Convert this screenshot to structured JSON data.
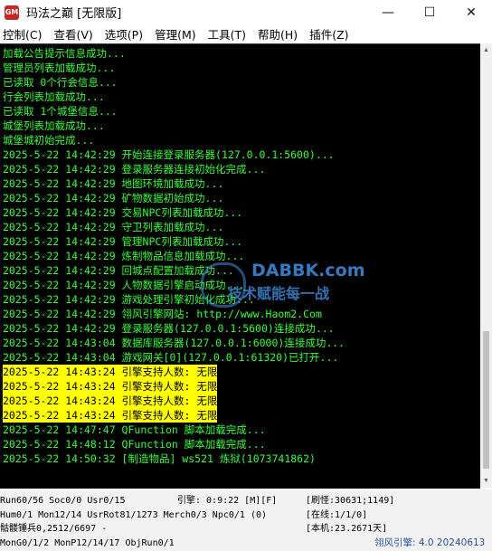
{
  "window": {
    "icon_text": "GM",
    "title": "玛法之巅 [无限版]",
    "min_glyph": "—",
    "max_glyph": "☐",
    "close_glyph": "✕"
  },
  "menu": [
    {
      "label": "控制(C)"
    },
    {
      "label": "查看(V)"
    },
    {
      "label": "选项(P)"
    },
    {
      "label": "管理(M)"
    },
    {
      "label": "工具(T)"
    },
    {
      "label": "帮助(H)"
    },
    {
      "label": "插件(Z)"
    }
  ],
  "console": {
    "text_color": "#33ff33",
    "highlight_color": "#ffff00",
    "lines": [
      {
        "text": "加载公告提示信息成功...",
        "hl": false
      },
      {
        "text": "管理员列表加载成功...",
        "hl": false
      },
      {
        "text": "已读取 0个行会信息...",
        "hl": false
      },
      {
        "text": "行会列表加载成功...",
        "hl": false
      },
      {
        "text": "已读取 1个城堡信息...",
        "hl": false
      },
      {
        "text": "城堡列表加载成功...",
        "hl": false
      },
      {
        "text": "城堡城初始完成...",
        "hl": false
      },
      {
        "text": "2025-5-22 14:42:29 开始连接登录服务器(127.0.0.1:5600)...",
        "hl": false
      },
      {
        "text": "2025-5-22 14:42:29 登录服务器连接初始化完成...",
        "hl": false
      },
      {
        "text": "2025-5-22 14:42:29 地图环境加载成功...",
        "hl": false
      },
      {
        "text": "2025-5-22 14:42:29 矿物数据初始成功...",
        "hl": false
      },
      {
        "text": "2025-5-22 14:42:29 交易NPC列表加载成功...",
        "hl": false
      },
      {
        "text": "2025-5-22 14:42:29 守卫列表加载成功...",
        "hl": false
      },
      {
        "text": "2025-5-22 14:42:29 管理NPC列表加载成功...",
        "hl": false
      },
      {
        "text": "2025-5-22 14:42:29 炼制物品信息加载成功...",
        "hl": false
      },
      {
        "text": "2025-5-22 14:42:29 回城点配置加载成功...",
        "hl": false
      },
      {
        "text": "2025-5-22 14:42:29 人物数据引擎启动成功...",
        "hl": false
      },
      {
        "text": "2025-5-22 14:42:29 游戏处理引擎初始化成功...",
        "hl": false
      },
      {
        "text": "2025-5-22 14:42:29 翎风引擎网站: http://www.Haom2.Com",
        "hl": false
      },
      {
        "text": "2025-5-22 14:42:29 登录服务器(127.0.0.1:5600)连接成功...",
        "hl": false
      },
      {
        "text": "2025-5-22 14:43:04 数据库服务器(127.0.0.1:6000)连接成功...",
        "hl": false
      },
      {
        "text": "2025-5-22 14:43:04 游戏网关[0](127.0.0.1:61320)已打开...",
        "hl": false
      },
      {
        "text": "2025-5-22 14:43:24 引擎支持人数: 无限",
        "hl": true
      },
      {
        "text": "2025-5-22 14:43:24 引擎支持人数: 无限",
        "hl": true
      },
      {
        "text": "2025-5-22 14:43:24 引擎支持人数: 无限",
        "hl": true
      },
      {
        "text": "2025-5-22 14:43:24 引擎支持人数: 无限",
        "hl": true
      },
      {
        "text": "2025-5-22 14:47:47 QFunction 脚本加载完成...",
        "hl": false
      },
      {
        "text": "2025-5-22 14:48:12 QFunction 脚本加载完成...",
        "hl": false
      },
      {
        "text": "2025-5-22 14:50:32 [制造物品] ws521 炼狱(1073741862)",
        "hl": false
      }
    ]
  },
  "scrollbar": {
    "up_glyph": "▲",
    "down_glyph": "▼"
  },
  "watermark": {
    "logo": "DABBK.com",
    "slogan": "技术赋能每一战"
  },
  "status": {
    "r1c1": "Run60/56 Soc0/0 Usr0/15",
    "r1c2": "引擎: 0:9:22 [M][F]",
    "r1c3": "[刷怪:30631;1149]",
    "r2c1": "Hum0/1 Mon12/14 UsrRot81/1273 Merch0/3 Npc0/1 (0)",
    "r2c3": "[在线:1/1/0]",
    "r3c1": "骷髅锤兵0,2512/6697 -",
    "r3c3": "[本机:23.2671天]",
    "r4c1": "MonG0/1/2 MonP12/14/17 ObjRun0/1",
    "r4c3": "翎风引擎: 4.0 20240613"
  }
}
